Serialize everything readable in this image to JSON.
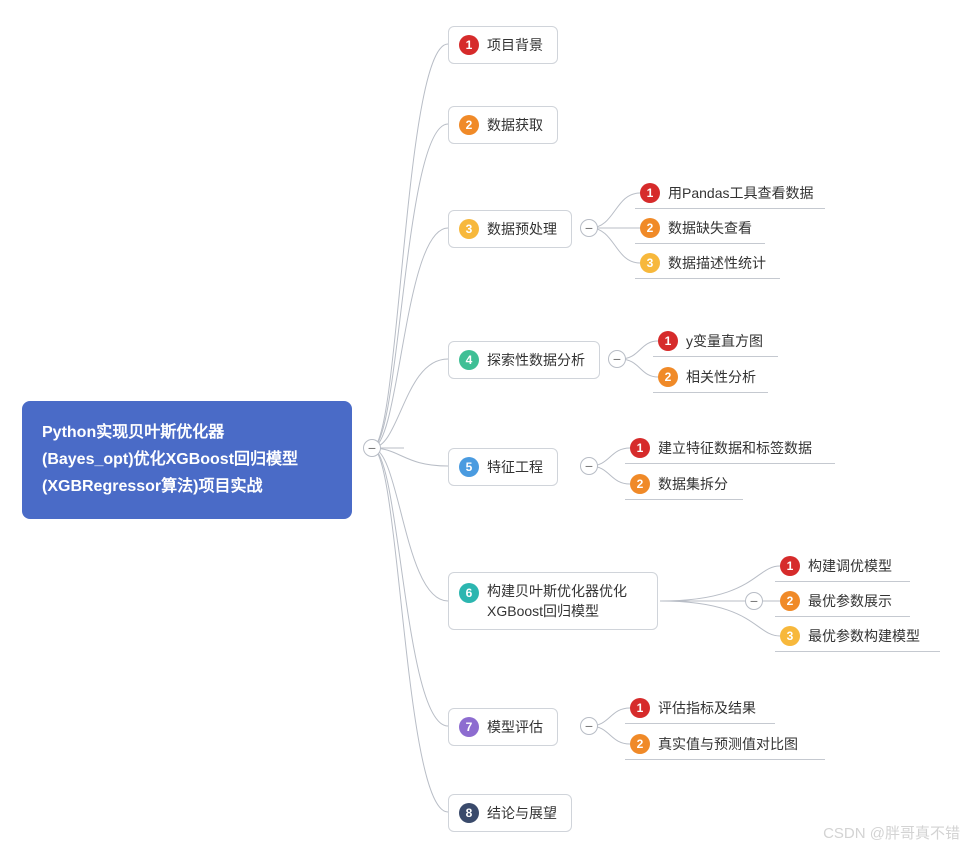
{
  "root": {
    "line1": "Python实现贝叶斯优化器",
    "line2": "(Bayes_opt)优化XGBoost回归模型",
    "line3": "(XGBRegressor算法)项目实战"
  },
  "branches": [
    {
      "num": "1",
      "label": "项目背景",
      "color": "#d62b2b"
    },
    {
      "num": "2",
      "label": "数据获取",
      "color": "#f08a28"
    },
    {
      "num": "3",
      "label": "数据预处理",
      "color": "#f7b83c",
      "children": [
        {
          "num": "1",
          "label": "用Pandas工具查看数据",
          "color": "#d62b2b"
        },
        {
          "num": "2",
          "label": "数据缺失查看",
          "color": "#f08a28"
        },
        {
          "num": "3",
          "label": "数据描述性统计",
          "color": "#f7b83c"
        }
      ]
    },
    {
      "num": "4",
      "label": "探索性数据分析",
      "color": "#3fbf95",
      "children": [
        {
          "num": "1",
          "label": "y变量直方图",
          "color": "#d62b2b"
        },
        {
          "num": "2",
          "label": "相关性分析",
          "color": "#f08a28"
        }
      ]
    },
    {
      "num": "5",
      "label": "特征工程",
      "color": "#4a9be0",
      "children": [
        {
          "num": "1",
          "label": "建立特征数据和标签数据",
          "color": "#d62b2b"
        },
        {
          "num": "2",
          "label": "数据集拆分",
          "color": "#f08a28"
        }
      ]
    },
    {
      "num": "6",
      "label_line1": "构建贝叶斯优化器优化",
      "label_line2": "XGBoost回归模型",
      "color": "#2cb6b0",
      "children": [
        {
          "num": "1",
          "label": "构建调优模型",
          "color": "#d62b2b"
        },
        {
          "num": "2",
          "label": "最优参数展示",
          "color": "#f08a28"
        },
        {
          "num": "3",
          "label": "最优参数构建模型",
          "color": "#f7b83c"
        }
      ]
    },
    {
      "num": "7",
      "label": "模型评估",
      "color": "#8d6cd0",
      "children": [
        {
          "num": "1",
          "label": "评估指标及结果",
          "color": "#d62b2b"
        },
        {
          "num": "2",
          "label": "真实值与预测值对比图",
          "color": "#f08a28"
        }
      ]
    },
    {
      "num": "8",
      "label": "结论与展望",
      "color": "#3a4a6b"
    }
  ],
  "collapse_symbol": "−",
  "watermark": "CSDN @胖哥真不错"
}
